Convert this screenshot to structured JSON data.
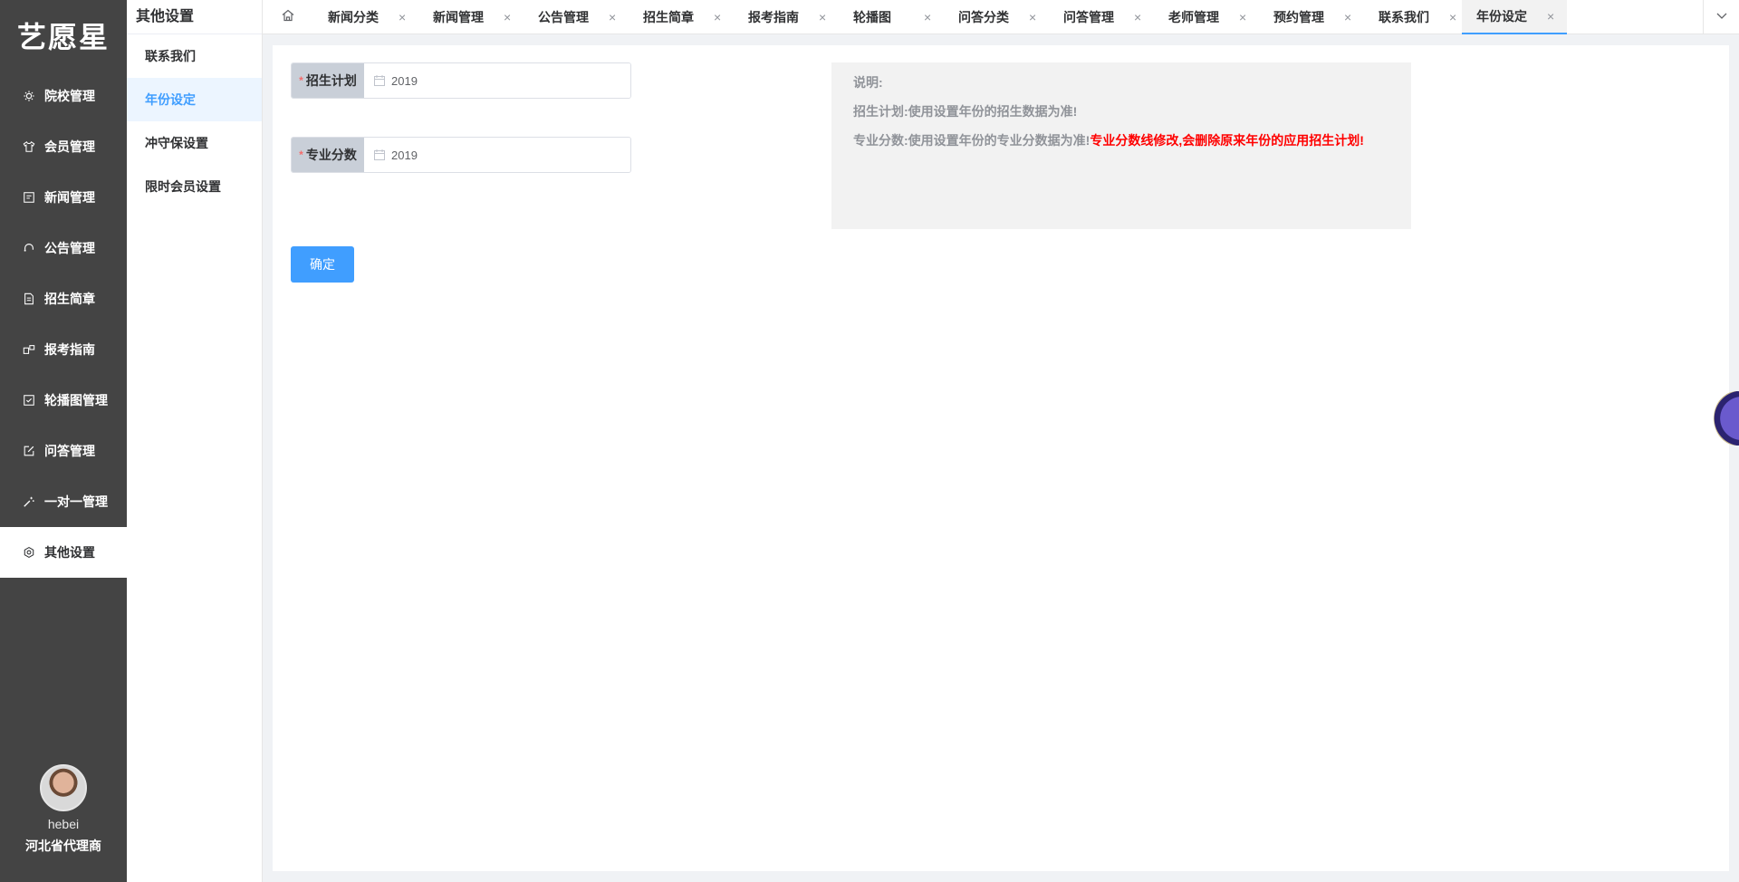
{
  "app": {
    "logo_text": "艺愿星"
  },
  "sidebar": {
    "items": [
      {
        "label": "院校管理",
        "icon": "gear-icon"
      },
      {
        "label": "会员管理",
        "icon": "shirt-icon"
      },
      {
        "label": "新闻管理",
        "icon": "news-icon"
      },
      {
        "label": "公告管理",
        "icon": "headset-icon"
      },
      {
        "label": "招生简章",
        "icon": "document-icon"
      },
      {
        "label": "报考指南",
        "icon": "guide-icon"
      },
      {
        "label": "轮播图管理",
        "icon": "checkbox-icon"
      },
      {
        "label": "问答管理",
        "icon": "edit-icon"
      },
      {
        "label": "一对一管理",
        "icon": "wand-icon"
      },
      {
        "label": "其他设置",
        "icon": "settings-icon",
        "active": true
      }
    ],
    "user": {
      "name": "hebei",
      "role": "河北省代理商"
    }
  },
  "submenu": {
    "title": "其他设置",
    "items": [
      {
        "label": "联系我们"
      },
      {
        "label": "年份设定",
        "active": true
      },
      {
        "label": "冲守保设置"
      },
      {
        "label": "限时会员设置"
      }
    ]
  },
  "tabs": [
    {
      "label": "新闻分类"
    },
    {
      "label": "新闻管理"
    },
    {
      "label": "公告管理"
    },
    {
      "label": "招生简章"
    },
    {
      "label": "报考指南"
    },
    {
      "label": "轮播图"
    },
    {
      "label": "问答分类"
    },
    {
      "label": "问答管理"
    },
    {
      "label": "老师管理"
    },
    {
      "label": "预约管理"
    },
    {
      "label": "联系我们"
    },
    {
      "label": "年份设定",
      "active": true
    }
  ],
  "tab_close_glyph": "×",
  "form": {
    "required_mark": "*",
    "enroll_plan": {
      "label": "招生计划",
      "value": "2019"
    },
    "major_score": {
      "label": "专业分数",
      "value": "2019"
    },
    "confirm_label": "确定"
  },
  "note": {
    "title": "说明:",
    "line1": "招生计划:使用设置年份的招生数据为准!",
    "line2": "专业分数:使用设置年份的专业分数据为准!",
    "warning": "专业分数线修改,会删除原来年份的应用招生计划!"
  },
  "colors": {
    "primary": "#409eff",
    "sidebar_bg": "#444444",
    "warning": "#ff0000"
  }
}
